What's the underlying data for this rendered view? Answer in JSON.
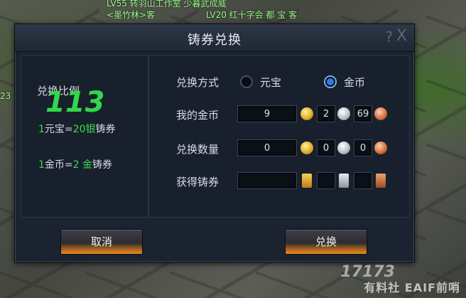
{
  "background": {
    "chat_lines": [
      "LV55 转羽山工作室 少暮武成威",
      "<墨竹林>客",
      "LV20 红十字会 都 宝 客"
    ],
    "side_number": "23"
  },
  "dialog": {
    "title": "铸券兑换",
    "help_glyph": "?",
    "close_glyph": "X"
  },
  "left": {
    "ratio_title": "兑换比例",
    "overlay_number": "113",
    "ratio1": {
      "lead": "1",
      "text_a": "元宝=",
      "value": "20",
      "unit": "银",
      "text_b": "铸券"
    },
    "ratio2": {
      "lead": "1",
      "text_a": "金币=",
      "value": "2",
      "unit": " 金",
      "text_b": "铸券"
    }
  },
  "right": {
    "method_label": "兑换方式",
    "option_yuanbao": "元宝",
    "option_gold": "金币",
    "selected_option": "金币",
    "my_gold_label": "我的金币",
    "my_gold": {
      "total": "9",
      "gold": "2",
      "silver": "69"
    },
    "amount_label": "兑换数量",
    "amount": {
      "total": "0",
      "gold": "0",
      "silver": "0"
    },
    "obtain_label": "获得铸券",
    "obtain": {
      "total": "",
      "gold": "",
      "silver": ""
    }
  },
  "buttons": {
    "cancel": "取消",
    "exchange": "兑换"
  },
  "watermark": {
    "logo_num": "17173",
    "text": "有料社 EAIF前哨"
  },
  "icons": [
    "gold-coin-icon",
    "silver-coin-icon",
    "copper-coin-icon",
    "gold-ticket-icon",
    "silver-ticket-icon",
    "copper-ticket-icon"
  ],
  "colors": {
    "accent_green": "#3ddc4f",
    "radio_blue": "#2f7ae6",
    "button_orange": "#e38a26"
  }
}
